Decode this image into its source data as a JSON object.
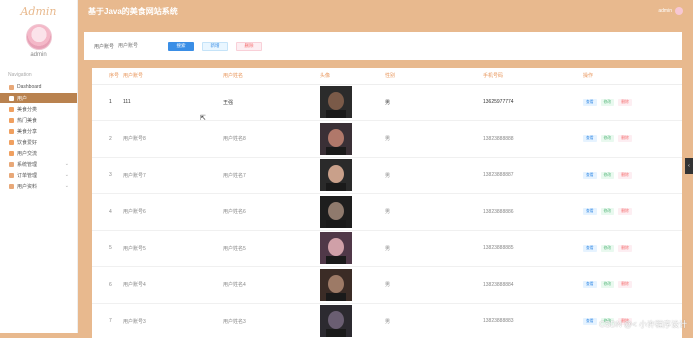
{
  "app": {
    "brand": "Admin",
    "title": "基于Java的美食网站系统",
    "top_user": "admin"
  },
  "sidebar": {
    "user_name": "admin",
    "nav_header": "Navigation",
    "items": [
      {
        "label": "Dashboard",
        "icon": "home-icon",
        "active": false,
        "has_sub": false
      },
      {
        "label": "用户",
        "icon": "user-icon",
        "active": true,
        "has_sub": false
      },
      {
        "label": "美食分类",
        "icon": "grid-icon",
        "active": false,
        "has_sub": false
      },
      {
        "label": "热门美食",
        "icon": "grid-icon",
        "active": false,
        "has_sub": false
      },
      {
        "label": "美食分享",
        "icon": "grid-icon",
        "active": false,
        "has_sub": false
      },
      {
        "label": "饮食爱好",
        "icon": "grid-icon",
        "active": false,
        "has_sub": false
      },
      {
        "label": "用户交流",
        "icon": "grid-icon",
        "active": false,
        "has_sub": false
      },
      {
        "label": "系统管理",
        "icon": "settings-icon",
        "active": false,
        "has_sub": true
      },
      {
        "label": "订单管理",
        "icon": "order-icon",
        "active": false,
        "has_sub": true
      },
      {
        "label": "用户资料",
        "icon": "profile-icon",
        "active": false,
        "has_sub": true
      }
    ]
  },
  "search": {
    "label": "用户账号",
    "placeholder": "用户账号",
    "search_btn": "搜索",
    "add_btn": "新增",
    "delete_btn": "删除"
  },
  "table": {
    "headers": [
      "序号",
      "用户账号",
      "用户姓名",
      "头像",
      "性别",
      "手机号码",
      "操作"
    ],
    "ops": {
      "view": "查看",
      "edit": "修改",
      "delete": "删除"
    },
    "rows": [
      {
        "index": "1",
        "account": "111",
        "name": "王强",
        "gender": "男",
        "phone": "13625977774"
      },
      {
        "index": "2",
        "account": "用户账号8",
        "name": "用户姓名8",
        "gender": "男",
        "phone": "13823888888"
      },
      {
        "index": "3",
        "account": "用户账号7",
        "name": "用户姓名7",
        "gender": "男",
        "phone": "13823888887"
      },
      {
        "index": "4",
        "account": "用户账号6",
        "name": "用户姓名6",
        "gender": "男",
        "phone": "13823888886"
      },
      {
        "index": "5",
        "account": "用户账号5",
        "name": "用户姓名5",
        "gender": "男",
        "phone": "13823888885"
      },
      {
        "index": "6",
        "account": "用户账号4",
        "name": "用户姓名4",
        "gender": "男",
        "phone": "13823888884"
      },
      {
        "index": "7",
        "account": "用户账号3",
        "name": "用户姓名3",
        "gender": "男",
        "phone": "13823888883"
      }
    ]
  },
  "watermark": "CSDN @< 小许程序设计",
  "colors": {
    "accent": "#e8b98e",
    "active_nav": "#b9824f",
    "primary": "#3a8ee6",
    "danger": "#f56c6c",
    "success": "#55b77a"
  }
}
